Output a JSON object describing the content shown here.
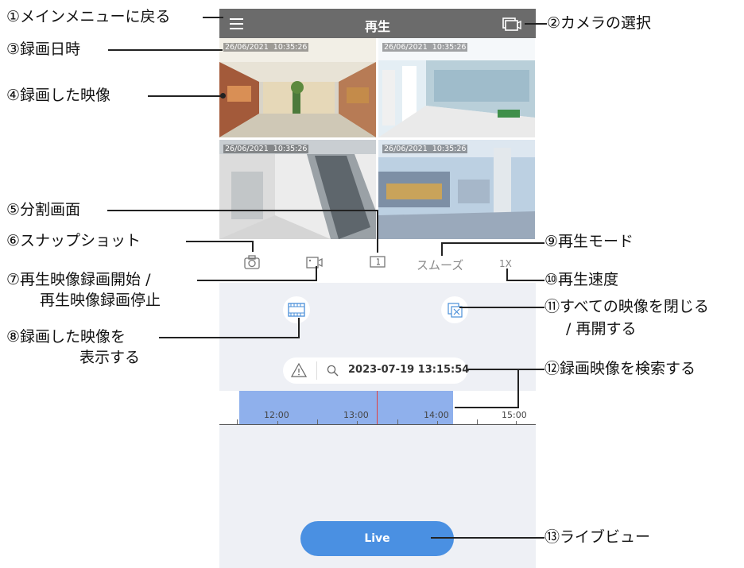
{
  "app": {
    "title": "再生"
  },
  "grid": {
    "timestamps": [
      "26/06/2021  10:35:26",
      "26/06/2021  10:35:26",
      "26/06/2021  10:35:26",
      "26/06/2021  10:35:26"
    ]
  },
  "toolbar": {
    "smooth_label": "スムーズ",
    "speed_label": "1X"
  },
  "search": {
    "datetime": "2023-07-19 13:15:54"
  },
  "timeline": {
    "labels": [
      "12:00",
      "13:00",
      "14:00",
      "15:00"
    ]
  },
  "live": {
    "label": "Live"
  },
  "annotations": {
    "a1": "①メインメニューに戻る",
    "a2": "②カメラの選択",
    "a3": "③録画日時",
    "a4": "④録画した映像",
    "a5": "⑤分割画面",
    "a6": "⑥スナップショット",
    "a7a": "⑦再生映像録画開始 /",
    "a7b": "再生映像録画停止",
    "a8a": "⑧録画した映像を",
    "a8b": "表示する",
    "a9": "⑨再生モード",
    "a10": "⑩再生速度",
    "a11a": "⑪すべての映像を閉じる",
    "a11b": "/ 再開する",
    "a12": "⑫録画映像を検索する",
    "a13": "⑬ライブビュー"
  },
  "colors": {
    "topbar": "#6b6b6b",
    "panel": "#eef0f5",
    "record_range": "#8fb0ec",
    "cursor": "#e04040",
    "live_button": "#4a90e2"
  },
  "icons": [
    "menu-icon",
    "camera-select-icon",
    "snapshot-icon",
    "record-icon",
    "split-screen-icon",
    "filmstrip-icon",
    "close-all-video-icon",
    "warning-icon",
    "search-icon"
  ]
}
